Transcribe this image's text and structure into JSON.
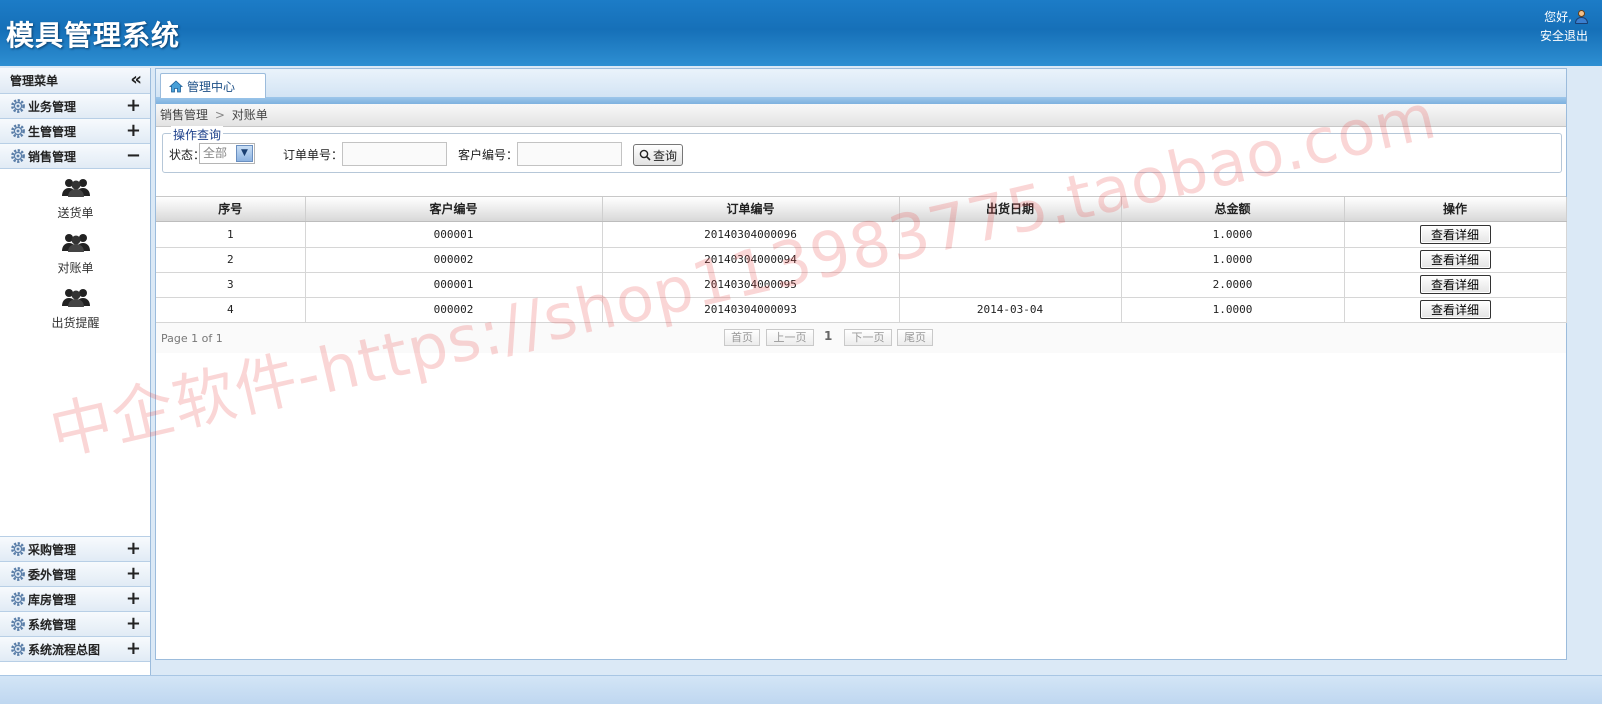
{
  "header": {
    "app_title": "模具管理系统",
    "greeting": "您好,",
    "logout_label": "安全退出"
  },
  "sidebar": {
    "title": "管理菜单",
    "collapse_glyph": "«",
    "categories_top": [
      {
        "label": "业务管理",
        "toggle": "+"
      },
      {
        "label": "生管管理",
        "toggle": "+"
      },
      {
        "label": "销售管理",
        "toggle": "−"
      }
    ],
    "sub_items": [
      {
        "label": "送货单"
      },
      {
        "label": "对账单"
      },
      {
        "label": "出货提醒"
      }
    ],
    "categories_bottom": [
      {
        "label": "采购管理",
        "toggle": "+"
      },
      {
        "label": "委外管理",
        "toggle": "+"
      },
      {
        "label": "库房管理",
        "toggle": "+"
      },
      {
        "label": "系统管理",
        "toggle": "+"
      },
      {
        "label": "系统流程总图",
        "toggle": "+"
      }
    ]
  },
  "tabs": {
    "home_label": "管理中心"
  },
  "breadcrumb": {
    "section": "销售管理",
    "separator": ">",
    "page": "对账单"
  },
  "query": {
    "legend": "操作查询",
    "status_label": "状态：",
    "status_value": "全部",
    "order_label": "订单单号：",
    "order_value": "",
    "customer_label": "客户编号：",
    "customer_value": "",
    "search_label": "查询"
  },
  "grid": {
    "columns": [
      "序号",
      "客户编号",
      "订单编号",
      "出货日期",
      "总金额",
      "操作"
    ],
    "rows": [
      {
        "seq": "1",
        "customer": "000001",
        "order": "20140304000096",
        "date": "",
        "amount": "1.0000",
        "action": "查看详细"
      },
      {
        "seq": "2",
        "customer": "000002",
        "order": "20140304000094",
        "date": "",
        "amount": "1.0000",
        "action": "查看详细"
      },
      {
        "seq": "3",
        "customer": "000001",
        "order": "20140304000095",
        "date": "",
        "amount": "2.0000",
        "action": "查看详细"
      },
      {
        "seq": "4",
        "customer": "000002",
        "order": "20140304000093",
        "date": "2014-03-04",
        "amount": "1.0000",
        "action": "查看详细"
      }
    ]
  },
  "pager": {
    "info": "Page 1 of 1",
    "first": "首页",
    "prev": "上一页",
    "current": "1",
    "next": "下一页",
    "last": "尾页"
  },
  "watermark": "中企软件-https://shop113983775.taobao.com",
  "colors": {
    "header_blue": "#1670b8",
    "watermark_red": "#e84646"
  }
}
